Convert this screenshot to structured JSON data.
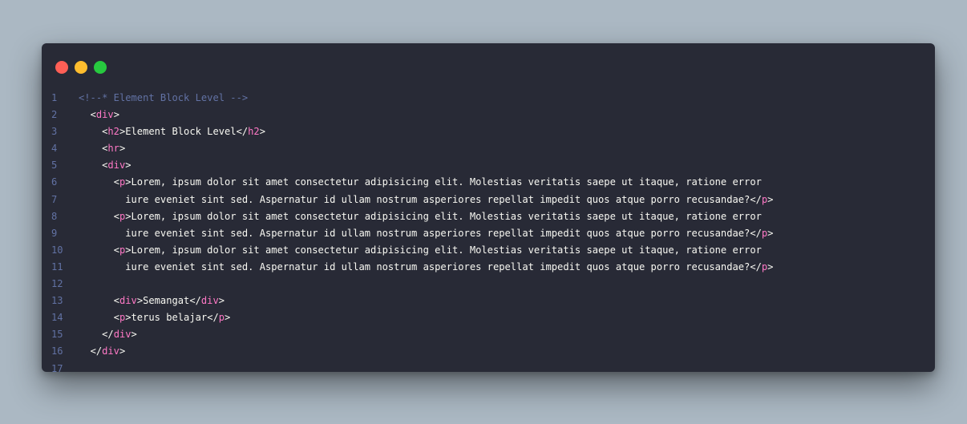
{
  "window": {
    "traffic_lights": [
      {
        "name": "close",
        "color": "#ff5f56"
      },
      {
        "name": "minimize",
        "color": "#ffbd2e"
      },
      {
        "name": "maximize",
        "color": "#27c93f"
      }
    ]
  },
  "colors": {
    "background": "#abb8c3",
    "editor": "#282a36",
    "tag": "#ff79c6",
    "comment": "#6272a4",
    "text": "#f8f8f2"
  },
  "code": {
    "lines": [
      {
        "number": "1",
        "indent": "",
        "tokens": [
          {
            "t": "comment",
            "v": "<!--* Element Block Level -->"
          }
        ]
      },
      {
        "number": "2",
        "indent": "  ",
        "tokens": [
          {
            "t": "punct",
            "v": "<"
          },
          {
            "t": "tag",
            "v": "div"
          },
          {
            "t": "punct",
            "v": ">"
          }
        ]
      },
      {
        "number": "3",
        "indent": "    ",
        "tokens": [
          {
            "t": "punct",
            "v": "<"
          },
          {
            "t": "tag",
            "v": "h2"
          },
          {
            "t": "punct",
            "v": ">"
          },
          {
            "t": "text",
            "v": "Element Block Level"
          },
          {
            "t": "punct",
            "v": "</"
          },
          {
            "t": "tag",
            "v": "h2"
          },
          {
            "t": "punct",
            "v": ">"
          }
        ]
      },
      {
        "number": "4",
        "indent": "    ",
        "tokens": [
          {
            "t": "punct",
            "v": "<"
          },
          {
            "t": "tag",
            "v": "hr"
          },
          {
            "t": "punct",
            "v": ">"
          }
        ]
      },
      {
        "number": "5",
        "indent": "    ",
        "tokens": [
          {
            "t": "punct",
            "v": "<"
          },
          {
            "t": "tag",
            "v": "div"
          },
          {
            "t": "punct",
            "v": ">"
          }
        ]
      },
      {
        "number": "6",
        "indent": "      ",
        "tokens": [
          {
            "t": "punct",
            "v": "<"
          },
          {
            "t": "tag",
            "v": "p"
          },
          {
            "t": "punct",
            "v": ">"
          },
          {
            "t": "text",
            "v": "Lorem, ipsum dolor sit amet consectetur adipisicing elit. Molestias veritatis saepe ut itaque, ratione error"
          }
        ]
      },
      {
        "number": "7",
        "indent": "        ",
        "tokens": [
          {
            "t": "text",
            "v": "iure eveniet sint sed. Aspernatur id ullam nostrum asperiores repellat impedit quos atque porro recusandae?"
          },
          {
            "t": "punct",
            "v": "</"
          },
          {
            "t": "tag",
            "v": "p"
          },
          {
            "t": "punct",
            "v": ">"
          }
        ]
      },
      {
        "number": "8",
        "indent": "      ",
        "tokens": [
          {
            "t": "punct",
            "v": "<"
          },
          {
            "t": "tag",
            "v": "p"
          },
          {
            "t": "punct",
            "v": ">"
          },
          {
            "t": "text",
            "v": "Lorem, ipsum dolor sit amet consectetur adipisicing elit. Molestias veritatis saepe ut itaque, ratione error"
          }
        ]
      },
      {
        "number": "9",
        "indent": "        ",
        "tokens": [
          {
            "t": "text",
            "v": "iure eveniet sint sed. Aspernatur id ullam nostrum asperiores repellat impedit quos atque porro recusandae?"
          },
          {
            "t": "punct",
            "v": "</"
          },
          {
            "t": "tag",
            "v": "p"
          },
          {
            "t": "punct",
            "v": ">"
          }
        ]
      },
      {
        "number": "10",
        "indent": "      ",
        "tokens": [
          {
            "t": "punct",
            "v": "<"
          },
          {
            "t": "tag",
            "v": "p"
          },
          {
            "t": "punct",
            "v": ">"
          },
          {
            "t": "text",
            "v": "Lorem, ipsum dolor sit amet consectetur adipisicing elit. Molestias veritatis saepe ut itaque, ratione error"
          }
        ]
      },
      {
        "number": "11",
        "indent": "        ",
        "tokens": [
          {
            "t": "text",
            "v": "iure eveniet sint sed. Aspernatur id ullam nostrum asperiores repellat impedit quos atque porro recusandae?"
          },
          {
            "t": "punct",
            "v": "</"
          },
          {
            "t": "tag",
            "v": "p"
          },
          {
            "t": "punct",
            "v": ">"
          }
        ]
      },
      {
        "number": "12",
        "indent": "",
        "tokens": []
      },
      {
        "number": "13",
        "indent": "      ",
        "tokens": [
          {
            "t": "punct",
            "v": "<"
          },
          {
            "t": "tag",
            "v": "div"
          },
          {
            "t": "punct",
            "v": ">"
          },
          {
            "t": "text",
            "v": "Semangat"
          },
          {
            "t": "punct",
            "v": "</"
          },
          {
            "t": "tag",
            "v": "div"
          },
          {
            "t": "punct",
            "v": ">"
          }
        ]
      },
      {
        "number": "14",
        "indent": "      ",
        "tokens": [
          {
            "t": "punct",
            "v": "<"
          },
          {
            "t": "tag",
            "v": "p"
          },
          {
            "t": "punct",
            "v": ">"
          },
          {
            "t": "text",
            "v": "terus belajar"
          },
          {
            "t": "punct",
            "v": "</"
          },
          {
            "t": "tag",
            "v": "p"
          },
          {
            "t": "punct",
            "v": ">"
          }
        ]
      },
      {
        "number": "15",
        "indent": "    ",
        "tokens": [
          {
            "t": "punct",
            "v": "</"
          },
          {
            "t": "tag",
            "v": "div"
          },
          {
            "t": "punct",
            "v": ">"
          }
        ]
      },
      {
        "number": "16",
        "indent": "  ",
        "tokens": [
          {
            "t": "punct",
            "v": "</"
          },
          {
            "t": "tag",
            "v": "div"
          },
          {
            "t": "punct",
            "v": ">"
          }
        ]
      },
      {
        "number": "17",
        "indent": "",
        "tokens": []
      }
    ]
  }
}
